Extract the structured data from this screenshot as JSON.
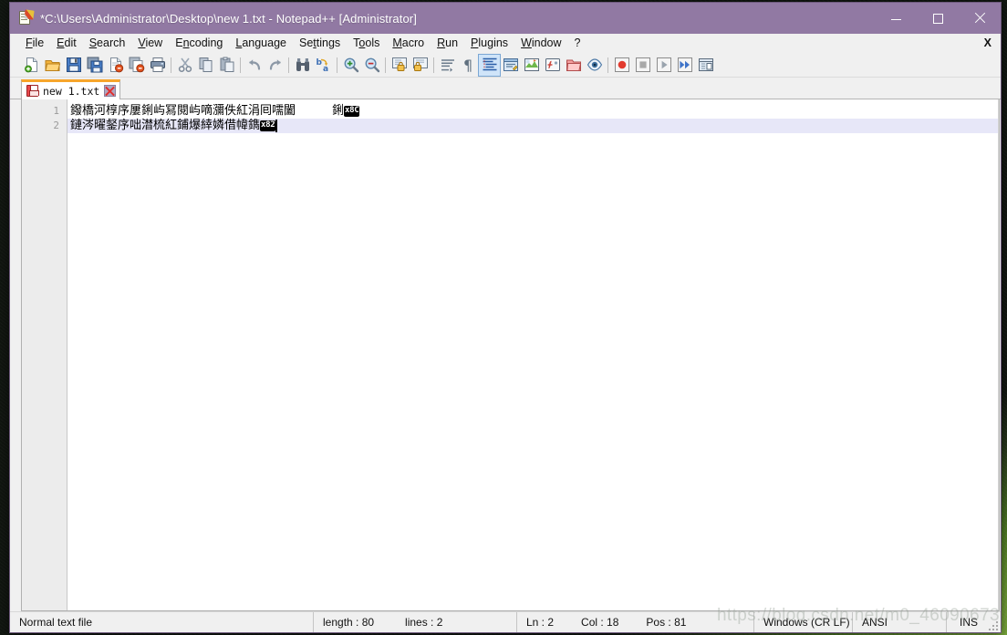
{
  "window": {
    "title": "*C:\\Users\\Administrator\\Desktop\\new 1.txt - Notepad++ [Administrator]",
    "app_icon": "notepad-plus-plus-icon",
    "titlebar_color": "#9179a3",
    "controls": {
      "minimize": "—",
      "maximize": "□",
      "close": "✕"
    }
  },
  "menubar": {
    "items": [
      {
        "label": "File",
        "mnemonic": "F"
      },
      {
        "label": "Edit",
        "mnemonic": "E"
      },
      {
        "label": "Search",
        "mnemonic": "S"
      },
      {
        "label": "View",
        "mnemonic": "V"
      },
      {
        "label": "Encoding",
        "mnemonic": "n"
      },
      {
        "label": "Language",
        "mnemonic": "L"
      },
      {
        "label": "Settings",
        "mnemonic": "t"
      },
      {
        "label": "Tools",
        "mnemonic": "o"
      },
      {
        "label": "Macro",
        "mnemonic": "M"
      },
      {
        "label": "Run",
        "mnemonic": "R"
      },
      {
        "label": "Plugins",
        "mnemonic": "P"
      },
      {
        "label": "Window",
        "mnemonic": "W"
      },
      {
        "label": "?",
        "mnemonic": ""
      }
    ],
    "close_document_label": "X"
  },
  "toolbar": {
    "buttons": [
      {
        "name": "new-file",
        "title": "New"
      },
      {
        "name": "open-file",
        "title": "Open"
      },
      {
        "name": "save-file",
        "title": "Save"
      },
      {
        "name": "save-all",
        "title": "Save All"
      },
      {
        "name": "close-file",
        "title": "Close"
      },
      {
        "name": "close-all",
        "title": "Close All"
      },
      {
        "name": "print",
        "title": "Print"
      },
      {
        "name": "separator-1",
        "title": ""
      },
      {
        "name": "cut",
        "title": "Cut"
      },
      {
        "name": "copy",
        "title": "Copy"
      },
      {
        "name": "paste",
        "title": "Paste"
      },
      {
        "name": "separator-2",
        "title": ""
      },
      {
        "name": "undo",
        "title": "Undo"
      },
      {
        "name": "redo",
        "title": "Redo"
      },
      {
        "name": "separator-3",
        "title": ""
      },
      {
        "name": "find",
        "title": "Find"
      },
      {
        "name": "replace",
        "title": "Replace"
      },
      {
        "name": "separator-4",
        "title": ""
      },
      {
        "name": "zoom-in",
        "title": "Zoom In"
      },
      {
        "name": "zoom-out",
        "title": "Zoom Out"
      },
      {
        "name": "separator-5",
        "title": ""
      },
      {
        "name": "sync-vertical-scroll",
        "title": "Synchronize Vertical Scrolling"
      },
      {
        "name": "sync-horizontal-scroll",
        "title": "Synchronize Horizontal Scrolling"
      },
      {
        "name": "separator-6",
        "title": ""
      },
      {
        "name": "word-wrap",
        "title": "Word wrap"
      },
      {
        "name": "show-all-characters",
        "title": "Show All Characters"
      },
      {
        "name": "show-indent-guide",
        "title": "Show Indent Guide"
      },
      {
        "name": "user-defined-dialog",
        "title": "User-Defined Dialogue"
      },
      {
        "name": "document-map",
        "title": "Document Map"
      },
      {
        "name": "function-list",
        "title": "Function List"
      },
      {
        "name": "folder-as-workspace",
        "title": "Folder as Workspace"
      },
      {
        "name": "monitoring",
        "title": "Monitoring"
      },
      {
        "name": "separator-7",
        "title": ""
      },
      {
        "name": "record-macro",
        "title": "Start Recording"
      },
      {
        "name": "stop-recording",
        "title": "Stop Recording"
      },
      {
        "name": "playback-macro",
        "title": "Playback"
      },
      {
        "name": "run-macro-multiple",
        "title": "Run a Macro Multiple Times"
      },
      {
        "name": "save-current-macro",
        "title": "Save Current Recorded Macro"
      }
    ]
  },
  "tabs": {
    "active_index": 0,
    "items": [
      {
        "label": "new 1.txt",
        "modified": true,
        "save_icon": "floppy-disk-red-icon",
        "close_icon": "close-x-icon"
      }
    ]
  },
  "editor": {
    "gutter_numbers": [
      "1",
      "2"
    ],
    "current_line": 2,
    "lines": [
      {
        "number": "1",
        "text_a": "鏺橋河椁序屢鋓屿冩閱屿嘀瀰佚紅涓囘嚅闔",
        "gap": "      ",
        "text_b": "鋓",
        "control_char": "x8C",
        "highlight": false
      },
      {
        "number": "2",
        "text_a": "鏈涔曜錖序咄澘梳紅鋪爆緈嫾借幃鐫",
        "gap": "",
        "text_b": "",
        "control_char": "x82",
        "highlight": true
      }
    ]
  },
  "statusbar": {
    "doc_type": "Normal text file",
    "length_label": "length : 80",
    "lines_label": "lines : 2",
    "ln_label": "Ln : 2",
    "col_label": "Col : 18",
    "pos_label": "Pos : 81",
    "eol": "Windows (CR LF)",
    "encoding": "ANSI",
    "insert_mode": "INS"
  },
  "watermark": {
    "text": "https://blog.csdn.net/m0_46090673"
  }
}
